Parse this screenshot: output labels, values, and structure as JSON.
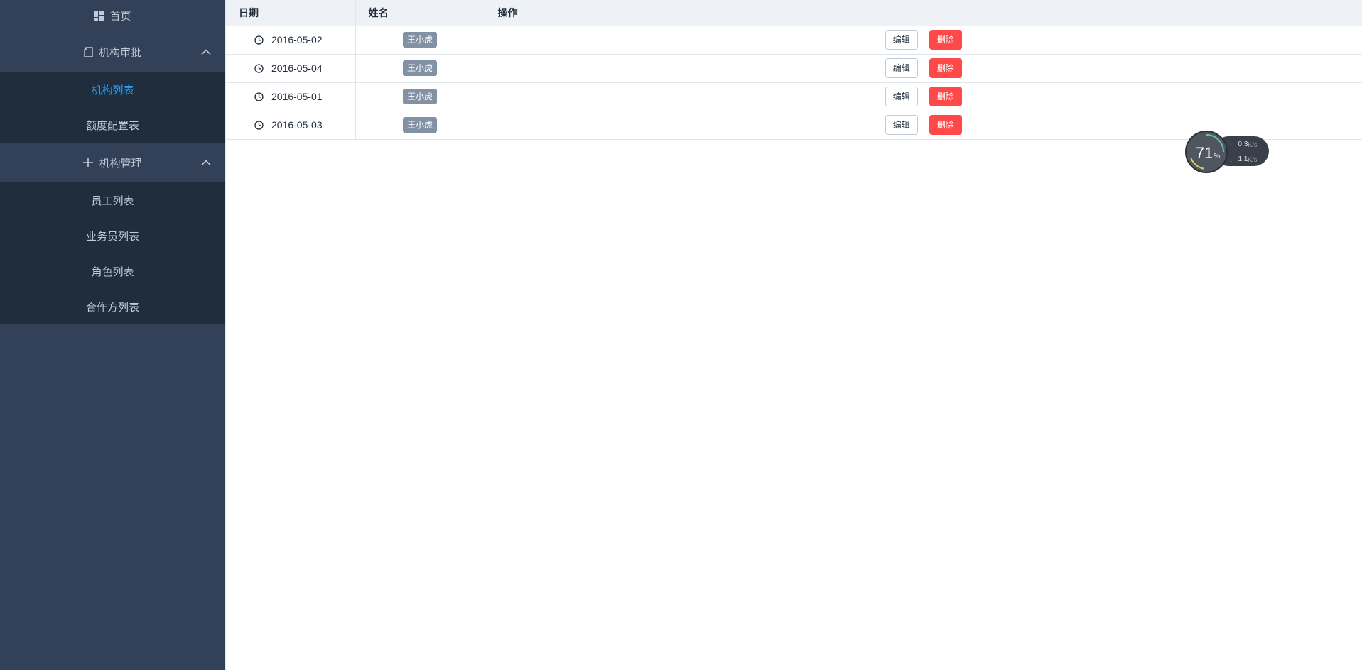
{
  "sidebar": {
    "home_label": "首页",
    "groups": [
      {
        "title": "机构审批",
        "items": [
          {
            "label": "机构列表",
            "active": true
          },
          {
            "label": "额度配置表",
            "active": false
          }
        ]
      },
      {
        "title": "机构管理",
        "items": [
          {
            "label": "员工列表",
            "active": false
          },
          {
            "label": "业务员列表",
            "active": false
          },
          {
            "label": "角色列表",
            "active": false
          },
          {
            "label": "合作方列表",
            "active": false
          }
        ]
      }
    ]
  },
  "table": {
    "headers": [
      "日期",
      "姓名",
      "操作"
    ],
    "rows": [
      {
        "date": "2016-05-02",
        "name": "王小虎"
      },
      {
        "date": "2016-05-04",
        "name": "王小虎"
      },
      {
        "date": "2016-05-01",
        "name": "王小虎"
      },
      {
        "date": "2016-05-03",
        "name": "王小虎"
      }
    ],
    "edit_label": "编辑",
    "delete_label": "删除"
  },
  "net_widget": {
    "percent": "71",
    "percent_symbol": "%",
    "upload_value": "0.3",
    "download_value": "1.1",
    "unit": "K/s"
  },
  "colors": {
    "sidebar_bg": "#324157",
    "submenu_bg": "#1f2d3d",
    "active_text": "#20a0ff",
    "danger": "#ff4949",
    "tag_bg": "#8391a5"
  }
}
